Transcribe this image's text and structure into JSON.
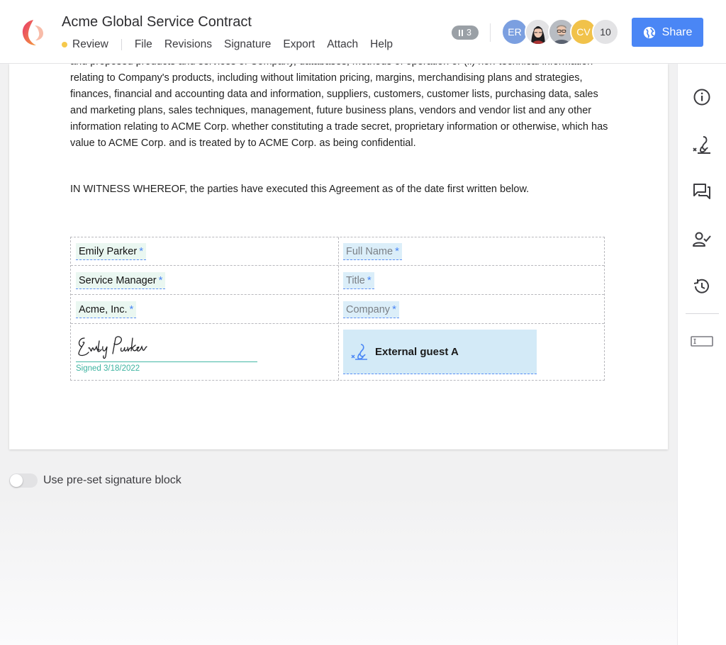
{
  "header": {
    "title": "Acme Global Service Contract",
    "status": {
      "label": "Review",
      "color": "#f6c94c"
    },
    "menu": [
      "File",
      "Revisions",
      "Signature",
      "Export",
      "Attach",
      "Help"
    ],
    "pause_count": "3",
    "collaborators": [
      {
        "initials": "ER",
        "color": "#7b9fe0"
      },
      {
        "initials": "",
        "color": "#cfcfd2",
        "icon": "user-photo-woman"
      },
      {
        "initials": "",
        "color": "#cfcfd2",
        "icon": "user-photo-man"
      },
      {
        "initials": "CV",
        "color": "#f1c24a"
      }
    ],
    "collaborator_more": "10",
    "share_label": "Share"
  },
  "document": {
    "para1": "and proposed products and services of Company, databases, methods of operation or (ii) non-technical information relating to Company's products, including without limitation pricing, margins, merchandising plans and strategies, finances, financial and accounting data and information, suppliers, customers, customer lists, purchasing data, sales and marketing plans, sales techniques, management, future business plans, vendors and vendor list and any other information relating to ACME Corp. whether constituting a trade secret, proprietary information or otherwise, which has value to ACME Corp. and is treated by to ACME Corp. as being confidential.",
    "para2": "IN WITNESS WHEREOF, the parties have executed this Agreement as of the date first written below."
  },
  "signature_block": {
    "left": {
      "name": "Emily Parker",
      "title": "Service Manager",
      "company": "Acme, Inc.",
      "signature_text": "Emily Parker",
      "signed_label": "Signed 3/18/2022"
    },
    "right": {
      "name_placeholder": "Full Name",
      "title_placeholder": "Title",
      "company_placeholder": "Company",
      "signer_label": "External guest A"
    },
    "required_mark": "*"
  },
  "preset_toggle": {
    "label": "Use pre-set signature block",
    "on": false
  },
  "sidebar_icons": [
    "info-icon",
    "signature-icon",
    "comments-icon",
    "approve-user-icon",
    "history-icon",
    "text-field-icon"
  ]
}
